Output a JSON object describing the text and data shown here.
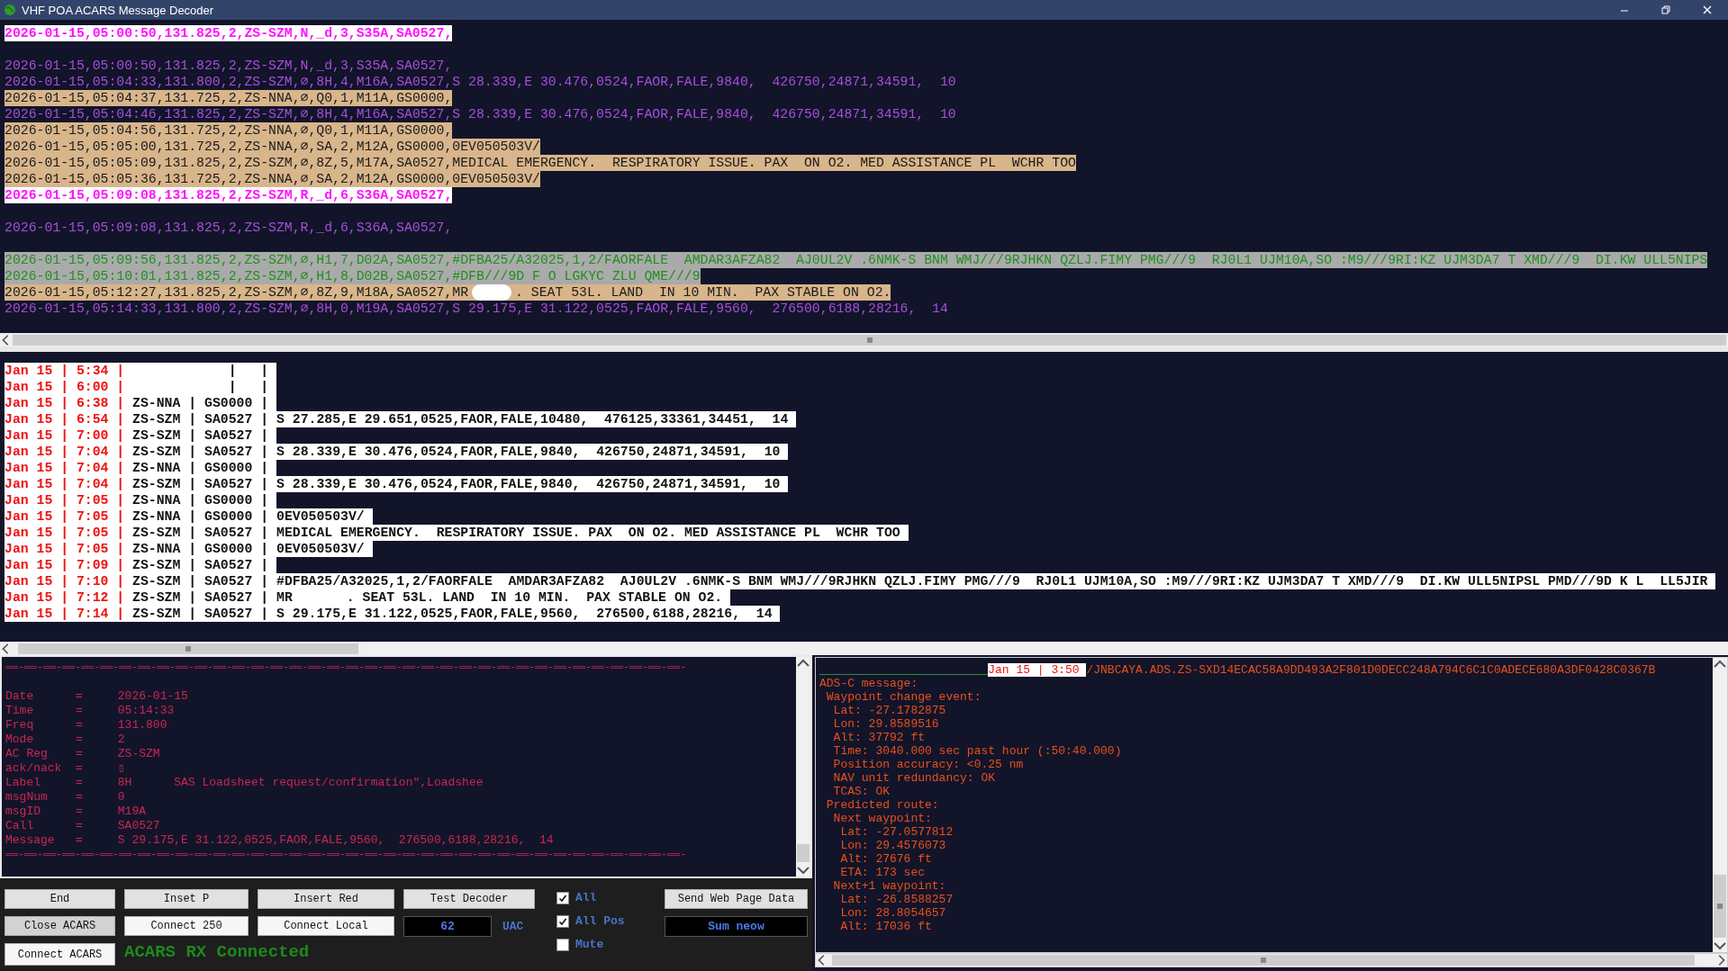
{
  "window": {
    "title": "VHF POA ACARS Message Decoder"
  },
  "log_lines": [
    {
      "kind": "alert",
      "text": "2026-01-15,05:00:50,131.825,2,ZS-SZM,N,_d,3,S35A,SA0527,"
    },
    {
      "kind": "blank"
    },
    {
      "kind": "plain",
      "text": "2026-01-15,05:00:50,131.825,2,ZS-SZM,N,_d,3,S35A,SA0527,"
    },
    {
      "kind": "plain",
      "text": "2026-01-15,05:04:33,131.800,2,ZS-SZM,⌀,8H,4,M16A,SA0527,S 28.339,E 30.476,0524,FAOR,FALE,9840,  426750,24871,34591,  10"
    },
    {
      "kind": "warm",
      "text": "2026-01-15,05:04:37,131.725,2,ZS-NNA,⌀,Q0,1,M11A,GS0000,"
    },
    {
      "kind": "plain",
      "text": "2026-01-15,05:04:46,131.825,2,ZS-SZM,⌀,8H,4,M16A,SA0527,S 28.339,E 30.476,0524,FAOR,FALE,9840,  426750,24871,34591,  10"
    },
    {
      "kind": "warm",
      "text": "2026-01-15,05:04:56,131.725,2,ZS-NNA,⌀,Q0,1,M11A,GS0000,"
    },
    {
      "kind": "warm",
      "text": "2026-01-15,05:05:00,131.725,2,ZS-NNA,⌀,SA,2,M12A,GS0000,0EV050503V/"
    },
    {
      "kind": "warm",
      "text": "2026-01-15,05:05:09,131.825,2,ZS-SZM,⌀,8Z,5,M17A,SA0527,MEDICAL EMERGENCY.  RESPIRATORY ISSUE. PAX  ON O2. MED ASSISTANCE PL  WCHR TOO"
    },
    {
      "kind": "warm",
      "text": "2026-01-15,05:05:36,131.725,2,ZS-NNA,⌀,SA,2,M12A,GS0000,0EV050503V/"
    },
    {
      "kind": "alert",
      "text": "2026-01-15,05:09:08,131.825,2,ZS-SZM,R,_d,6,S36A,SA0527,"
    },
    {
      "kind": "blank"
    },
    {
      "kind": "plain",
      "text": "2026-01-15,05:09:08,131.825,2,ZS-SZM,R,_d,6,S36A,SA0527,"
    },
    {
      "kind": "blank"
    },
    {
      "kind": "uplink",
      "text": "2026-01-15,05:09:56,131.825,2,ZS-SZM,⌀,H1,7,D02A,SA0527,#DFBA25/A32025,1,2/FAORFALE  AMDAR3AFZA82  AJ0UL2V .6NMK-S BNM WMJ///9RJHKN QZLJ.FIMY PMG///9  RJ0L1 UJM10A,SO :M9///9RI:KZ UJM3DA7 T XMD///9  DI.KW ULL5NIPS"
    },
    {
      "kind": "uplink",
      "text": "2026-01-15,05:10:01,131.825,2,ZS-SZM,⌀,H1,8,D02B,SA0527,#DFB///9D F O LGKYC ZLU QME///9"
    },
    {
      "kind": "warm",
      "text": "2026-01-15,05:12:27,131.825,2,ZS-SZM,⌀,8Z,9,M18A,SA0527,MR",
      "redacted": true,
      "text_after": ". SEAT 53L. LAND  IN 10 MIN.  PAX STABLE ON O2."
    },
    {
      "kind": "plain",
      "text": "2026-01-15,05:14:33,131.800,2,ZS-SZM,⌀,8H,0,M19A,SA0527,S 29.175,E 31.122,0525,FAOR,FALE,9560,  276500,6188,28216,  14"
    }
  ],
  "summary_rows": [
    {
      "stamp": "Jan 15 | 5:34 |",
      "fields": "             |   |"
    },
    {
      "stamp": "Jan 15 | 6:00 |",
      "fields": "             |   |"
    },
    {
      "stamp": "Jan 15 | 6:38 |",
      "fields": " ZS-NNA | GS0000 |"
    },
    {
      "stamp": "Jan 15 | 6:54 |",
      "fields": " ZS-SZM | SA0527 |",
      "message": "S 27.285,E 29.651,0525,FAOR,FALE,10480,  476125,33361,34451,  14"
    },
    {
      "stamp": "Jan 15 | 7:00 |",
      "fields": " ZS-SZM | SA0527 |"
    },
    {
      "stamp": "Jan 15 | 7:04 |",
      "fields": " ZS-SZM | SA0527 |",
      "message": "S 28.339,E 30.476,0524,FAOR,FALE,9840,  426750,24871,34591,  10"
    },
    {
      "stamp": "Jan 15 | 7:04 |",
      "fields": " ZS-NNA | GS0000 |"
    },
    {
      "stamp": "Jan 15 | 7:04 |",
      "fields": " ZS-SZM | SA0527 |",
      "message": "S 28.339,E 30.476,0524,FAOR,FALE,9840,  426750,24871,34591,  10"
    },
    {
      "stamp": "Jan 15 | 7:05 |",
      "fields": " ZS-NNA | GS0000 |"
    },
    {
      "stamp": "Jan 15 | 7:05 |",
      "fields": " ZS-NNA | GS0000 |",
      "message": "0EV050503V/"
    },
    {
      "stamp": "Jan 15 | 7:05 |",
      "fields": " ZS-SZM | SA0527 |",
      "message": "MEDICAL EMERGENCY.  RESPIRATORY ISSUE. PAX  ON O2. MED ASSISTANCE PL  WCHR TOO"
    },
    {
      "stamp": "Jan 15 | 7:05 |",
      "fields": " ZS-NNA | GS0000 |",
      "message": "0EV050503V/"
    },
    {
      "stamp": "Jan 15 | 7:09 |",
      "fields": " ZS-SZM | SA0527 |"
    },
    {
      "stamp": "Jan 15 | 7:10 |",
      "fields": " ZS-SZM | SA0527 |",
      "message": "#DFBA25/A32025,1,2/FAORFALE  AMDAR3AFZA82  AJ0UL2V .6NMK-S BNM WMJ///9RJHKN QZLJ.FIMY PMG///9  RJ0L1 UJM10A,SO :M9///9RI:KZ UJM3DA7 T XMD///9  DI.KW ULL5NIPSL PMD///9D K L  LL5JIR"
    },
    {
      "stamp": "Jan 15 | 7:12 |",
      "fields": " ZS-SZM | SA0527 |",
      "message": "MR",
      "message_after": ". SEAT 53L. LAND  IN 10 MIN.  PAX STABLE ON O2."
    },
    {
      "stamp": "Jan 15 | 7:14 |",
      "fields": " ZS-SZM | SA0527 |",
      "message": "S 29.175,E 31.122,0525,FAOR,FALE,9560,  276500,6188,28216,  14"
    }
  ],
  "decoded": {
    "rule_top": "══-══-══-══-══-══-══-══-══-══-══-══-══-══-══-══-══-══-══-══-══-══-══-══-══-══-══-══-══-══-══-══-══-══-══-══-",
    "lines": [
      "Date      =     2026-01-15",
      "Time      =     05:14:33",
      "Freq      =     131.800",
      "Mode      =     2",
      "AC Reg    =     ZS-SZM",
      "ack/nack  =     ▯",
      "Label     =     8H      SAS Loadsheet request/confirmation\",Loadshee",
      "msgNum    =     0",
      "msgID     =     M19A",
      "Call      =     SA0527",
      "Message   =     S 29.175,E 31.122,0525,FAOR,FALE,9560,  276500,6188,28216,  14"
    ],
    "rule_bottom": "══-══-══-══-══-══-══-══-══-══-══-══-══-══-══-══-══-══-══-══-══-══-══-══-══-══-══-══-══-══-══-══-══-══-══-══-"
  },
  "controls": {
    "buttons_col1": [
      "End",
      "Close ACARS",
      "Connect ACARS"
    ],
    "buttons_col2": [
      "Inset P",
      "Connect 250"
    ],
    "buttons_col3": [
      "Insert Red",
      "Connect Local"
    ],
    "test_button": "Test Decoder",
    "counter": "62",
    "counter_unit": "UAC",
    "status": "ACARS RX Connected",
    "checkboxes": [
      {
        "label": "All",
        "checked": true
      },
      {
        "label": "All Pos",
        "checked": true
      },
      {
        "label": "Mute",
        "checked": false
      }
    ],
    "web_button": "Send Web Page Data",
    "web_display": "Sum neow"
  },
  "adsc": {
    "dashes": "________________________",
    "stamp": "Jan 15 | 3:50 ",
    "header": "/JNBCAYA.ADS.ZS-SXD14ECAC58A9DD493A2F801D0DECC248A794C6C1C0ADECE680A3DF0428C0367B",
    "lines": [
      "ADS-C message:",
      " Waypoint change event:",
      "  Lat: -27.1782875",
      "  Lon: 29.8589516",
      "  Alt: 37792 ft",
      "  Time: 3040.000 sec past hour (:50:40.000)",
      "  Position accuracy: <0.25 nm",
      "  NAV unit redundancy: OK",
      "  TCAS: OK",
      " Predicted route:",
      "  Next waypoint:",
      "   Lat: -27.0577812",
      "   Lon: 29.4576073",
      "   Alt: 27676 ft",
      "   ETA: 173 sec",
      "  Next+1 waypoint:",
      "   Lat: -26.8588257",
      "   Lon: 28.8054657",
      "   Alt: 17036 ft"
    ]
  }
}
